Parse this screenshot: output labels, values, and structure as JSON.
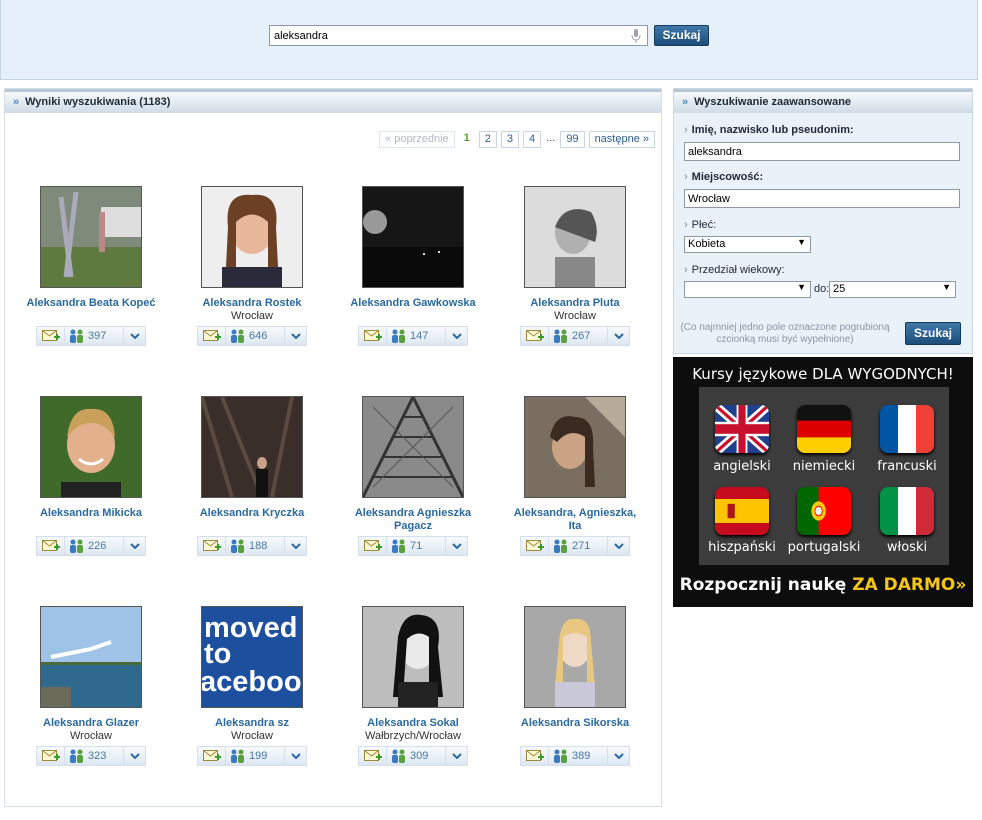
{
  "search": {
    "value": "aleksandra",
    "button_label": "Szukaj"
  },
  "results": {
    "title": "Wyniki wyszukiwania (1183)",
    "pager": {
      "prev": "« poprzednie",
      "current": "1",
      "pages": [
        "2",
        "3",
        "4"
      ],
      "dots": "...",
      "last": "99",
      "next": "następne »"
    },
    "profiles": [
      {
        "name": "Aleksandra Beata Kopeć",
        "city": "",
        "fans": "397"
      },
      {
        "name": "Aleksandra Rostek",
        "city": "Wrocław",
        "fans": "646"
      },
      {
        "name": "Aleksandra Gawkowska",
        "city": "",
        "fans": "147"
      },
      {
        "name": "Aleksandra Pluta",
        "city": "Wrocław",
        "fans": "267"
      },
      {
        "name": "Aleksandra Mikicka",
        "city": "",
        "fans": "226"
      },
      {
        "name": "Aleksandra Kryczka",
        "city": "",
        "fans": "188"
      },
      {
        "name": "Aleksandra Agnieszka Pagacz",
        "city": "",
        "fans": "71"
      },
      {
        "name": "Aleksandra, Agnieszka, Ita",
        "city": "",
        "fans": "271"
      },
      {
        "name": "Aleksandra Glazer",
        "city": "Wrocław",
        "fans": "323"
      },
      {
        "name": "Aleksandra sz",
        "city": "Wrocław",
        "fans": "199"
      },
      {
        "name": "Aleksandra Sokal",
        "city": "Wałbrzych/Wrocław",
        "fans": "309"
      },
      {
        "name": "Aleksandra Sikorska",
        "city": "",
        "fans": "389"
      }
    ],
    "moved_photo_text": [
      "moved",
      "to",
      "aceboo"
    ]
  },
  "advanced": {
    "title": "Wyszukiwanie zaawansowane",
    "name_label": "Imię, nazwisko lub pseudonim:",
    "name_value": "aleksandra",
    "city_label": "Miejscowość:",
    "city_value": "Wrocław",
    "gender_label": "Płeć:",
    "gender_value": "Kobieta",
    "age_label": "Przedział wiekowy:",
    "age_from": "",
    "age_to_label": "do:",
    "age_to": "25",
    "note": "(Co najmniej jedno pole oznaczone pogrubioną czcionką musi być wypełnione)",
    "button_label": "Szukaj"
  },
  "ad": {
    "title": "Kursy językowe DLA WYGODNYCH!",
    "languages": [
      "angielski",
      "niemiecki",
      "francuski",
      "hiszpański",
      "portugalski",
      "włoski"
    ],
    "cta_prefix": "Rozpocznij naukę ",
    "cta_highlight": "ZA DARMO»"
  },
  "colors": {
    "link": "#2a6aa0",
    "button": "#1c4d7b",
    "accent_green": "#5a9e2c",
    "ad_yellow": "#f5c518"
  }
}
